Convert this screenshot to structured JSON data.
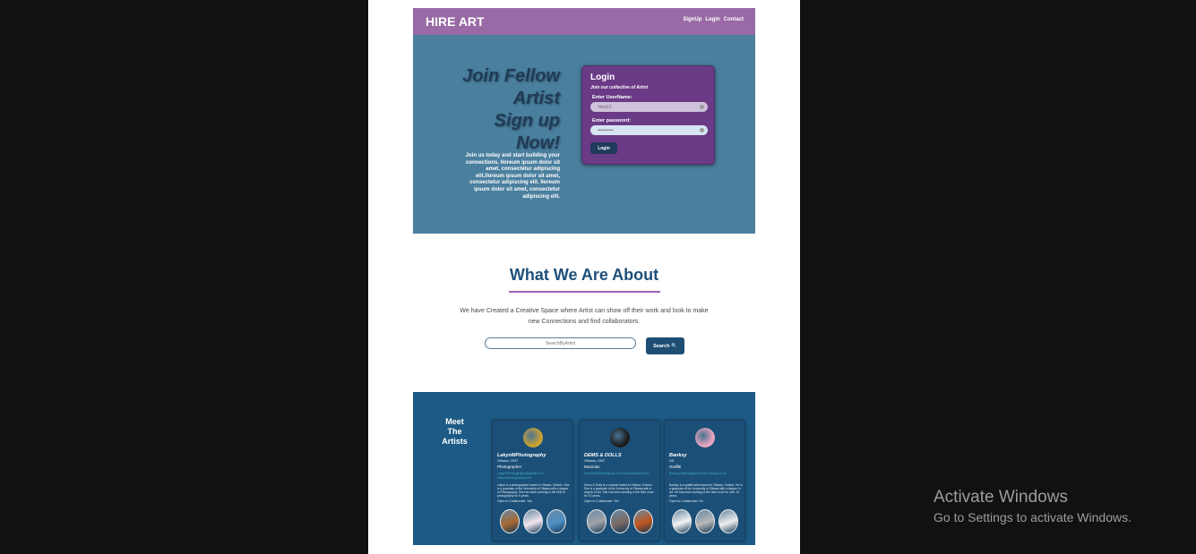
{
  "navbar": {
    "brand": "HIRE ART",
    "links": [
      "SignUp",
      "Login",
      "Contact"
    ]
  },
  "hero": {
    "title_lines": [
      "Join Fellow",
      "Artist",
      "Sign up",
      "Now!"
    ],
    "text": "Join us today and start building your connections. Iloreum ipsum dolor sit amet, consectetur adipiscing elit.Iloreum ipsum dolor sit amet, consectetur adipiscing elit. Iloreum ipsum dolor sit amet, consectetur adipiscing elit."
  },
  "login": {
    "title": "Login",
    "subtitle": "Join our collective of Artist",
    "username_label": "Enter UserName:",
    "username_value": "Vera11",
    "password_label": "Enter password:",
    "password_value": "••••••••••",
    "button": "Login"
  },
  "about": {
    "title": "What We Are About",
    "text": "We have Created a Creative Space where Artist can show off their work and look to make new Connections and find collaborators.",
    "search_placeholder": "SearchByArtist",
    "search_button": "Search 🔍"
  },
  "artists": {
    "heading_lines": [
      "Meet",
      "The",
      "Artists"
    ],
    "cards": [
      {
        "name": "LakynMPhotography",
        "location": "Ottawa, ONT",
        "role": "Photographer",
        "contact": "LakynMPhotography@gmail.com lakynmphotography.com",
        "bio": "Lakyn is a photographer based in Ottawa, Ontario. She is a graduate of the University of Ottawa with a degree in Photography. She has been working in the field of photography for 5 years.",
        "collab": "Open to Collaborate:   Yes",
        "avatar_color": "#c9a233",
        "thumb_colors": [
          "#a8682f",
          "#f2e6ee",
          "#4f8fc4"
        ]
      },
      {
        "name": "DEMS & DOLLS",
        "location": "Ottawa, ONT",
        "role": "Musician",
        "contact": "DemsandDolls@gmail.com demsanddolls.com",
        "bio": "Dems & Dolls is a musical based in Ottawa, Ontario. She is a graduate of the University of Ottawa with a degree in Art. She has been working in the field of art for 10 years.",
        "collab": "Open to Collaborate:   Yes",
        "avatar_color": "#1c1c1c",
        "thumb_colors": [
          "#a0a3a8",
          "#7a6a64",
          "#c2541c"
        ]
      },
      {
        "name": "Banksy",
        "location": "UK",
        "role": "Graffiti",
        "contact": "Banksy.Official@gmail.com banksy.co.uk",
        "bio": "Banksy is a graffiti artist based in Ottawa, Ontario. He is a graduate of the University of Ottawa with a degree in Art. He has been working in the field of art for over 15 years.",
        "collab": "Open to Collaborate:   No",
        "avatar_color": "#e6a4bd",
        "thumb_colors": [
          "#f4f4f4",
          "#b8b8b8",
          "#ededed"
        ]
      }
    ]
  },
  "watermark": {
    "title": "Activate Windows",
    "subtitle": "Go to Settings to activate Windows."
  }
}
